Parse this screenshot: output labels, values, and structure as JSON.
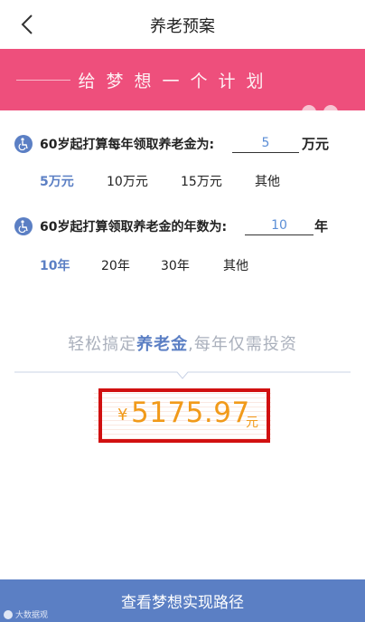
{
  "header": {
    "title": "养老预案"
  },
  "banner": {
    "slogan": "给梦想一个计划"
  },
  "question1": {
    "label": "60岁起打算每年领取养老金为:",
    "value": "5",
    "unit": "万元",
    "options": [
      {
        "label": "5万元",
        "selected": true
      },
      {
        "label": "10万元",
        "selected": false
      },
      {
        "label": "15万元",
        "selected": false
      },
      {
        "label": "其他",
        "selected": false
      }
    ]
  },
  "question2": {
    "label": "60岁起打算领取养老金的年数为:",
    "value": "10",
    "unit": "年",
    "options": [
      {
        "label": "10年",
        "selected": true
      },
      {
        "label": "20年",
        "selected": false
      },
      {
        "label": "30年",
        "selected": false
      },
      {
        "label": "其他",
        "selected": false
      }
    ]
  },
  "tagline": {
    "prefix": "轻松搞定",
    "highlight": "养老金",
    "suffix": ",每年仅需投资"
  },
  "result": {
    "currency": "¥",
    "amount": "5175.97",
    "unit": "元"
  },
  "cta": {
    "label": "查看梦想实现路径"
  },
  "watermark": {
    "text": "大数据观"
  },
  "colors": {
    "banner": "#ee4f7c",
    "accent": "#5b7fc4",
    "amount": "#f19a1a",
    "highlight_box": "#d11010"
  },
  "icons": {
    "back": "chevron-left-icon",
    "question": "wheelchair-icon",
    "banner": "elderly-couple-icon"
  }
}
